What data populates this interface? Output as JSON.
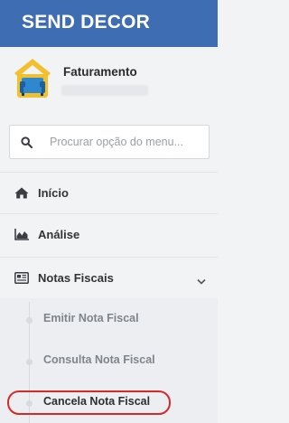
{
  "header": {
    "brand": "SEND DECOR"
  },
  "profile": {
    "name": "Faturamento",
    "avatar_icon": "sofa-house-icon"
  },
  "search": {
    "placeholder": "Procurar opção do menu..."
  },
  "nav": {
    "items": [
      {
        "label": "Início",
        "icon": "home-icon"
      },
      {
        "label": "Análise",
        "icon": "area-chart-icon"
      },
      {
        "label": "Notas Fiscais",
        "icon": "newspaper-icon",
        "expanded": true
      }
    ],
    "sub_items": [
      {
        "label": "Emitir Nota Fiscal"
      },
      {
        "label": "Consulta Nota Fiscal"
      },
      {
        "label": "Cancela Nota Fiscal",
        "active": true
      }
    ]
  },
  "colors": {
    "brand_bar": "#3f6db3",
    "highlight": "#d62929"
  }
}
